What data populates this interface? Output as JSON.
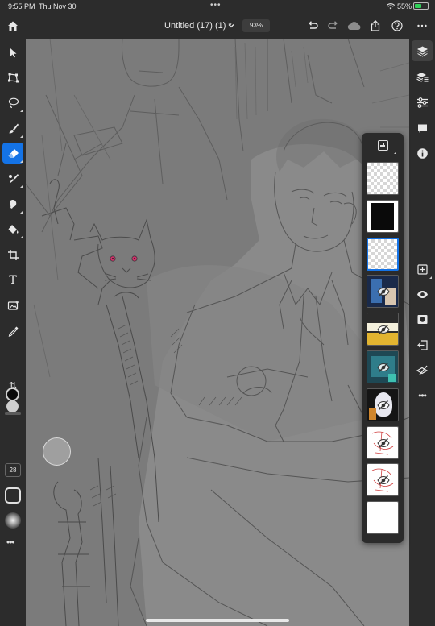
{
  "status_bar": {
    "time": "9:55 PM",
    "date": "Thu Nov 30",
    "multitask_dots": "•••",
    "battery_percent": "55%",
    "battery_level": 0.55,
    "battery_color": "#30d158"
  },
  "top_bar": {
    "document_title": "Untitled (17) (1) *",
    "zoom": "93%",
    "icons": [
      "home-icon",
      "chevron-down-icon",
      "undo-icon",
      "redo-icon",
      "cloud-icon",
      "share-icon",
      "help-icon",
      "more-icon"
    ]
  },
  "left_toolbar": {
    "tools": [
      "select-icon",
      "transform-icon",
      "lasso-icon",
      "brush-icon",
      "eraser-icon",
      "smudge-icon",
      "liquify-icon",
      "fill-icon",
      "crop-icon",
      "type-icon",
      "place-image-icon",
      "eyedropper-icon"
    ],
    "active_tool": "eraser-icon",
    "type_glyph": "T",
    "swap_glyph": "⇅",
    "foreground_color": "#0a0a0a",
    "background_color": "#cfcfcf",
    "brush_size": "28",
    "more_glyph": "•••"
  },
  "right_toolbar": {
    "icons": [
      "layers-icon",
      "layer-properties-icon",
      "adjustments-icon",
      "comments-icon",
      "info-icon",
      "add-layer-icon",
      "visibility-icon",
      "mask-icon",
      "import-icon",
      "clear-layer-icon",
      "more-icon"
    ],
    "active_icon": "layers-icon",
    "more_glyph": "•••"
  },
  "layers_panel": {
    "add_icon": "add-layer-icon",
    "layers": [
      {
        "kind": "transparent",
        "hidden": false,
        "selected": false
      },
      {
        "kind": "black-fill",
        "hidden": false,
        "selected": false
      },
      {
        "kind": "transparent",
        "hidden": false,
        "selected": true
      },
      {
        "kind": "art-dark",
        "hidden": true,
        "selected": false
      },
      {
        "kind": "art-yellow",
        "hidden": true,
        "selected": false
      },
      {
        "kind": "art-teal",
        "hidden": true,
        "selected": false
      },
      {
        "kind": "art-portrait",
        "hidden": true,
        "selected": false
      },
      {
        "kind": "sketch-red",
        "hidden": true,
        "selected": false
      },
      {
        "kind": "sketch-red",
        "hidden": true,
        "selected": false
      },
      {
        "kind": "white-fill",
        "hidden": false,
        "selected": false
      }
    ]
  },
  "colors": {
    "accent": "#1473e6",
    "chrome": "#2c2c2c",
    "canvas_gray": "#7b7b7b",
    "cat_eye": "#d0306a"
  }
}
